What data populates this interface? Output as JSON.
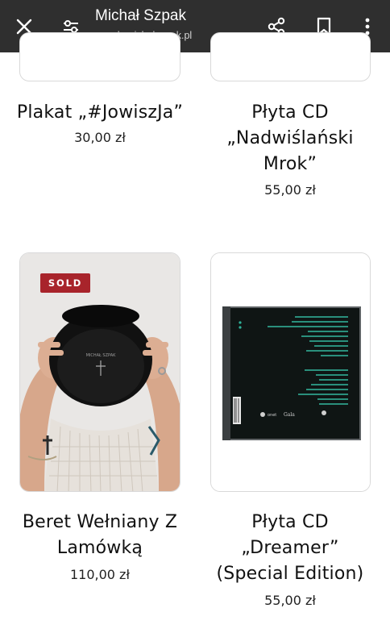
{
  "browser": {
    "title": "Michał Szpak",
    "url": "merch.michalszpak.pl",
    "icons": [
      "close-icon",
      "tune-icon",
      "share-icon",
      "bookmark-icon",
      "more-vert-icon"
    ]
  },
  "products": [
    {
      "title_lines": [
        "Plakat „#JowiszJa”"
      ],
      "price": "30,00 zł",
      "badge": ""
    },
    {
      "title_lines": [
        "Płyta CD",
        "„Nadwiślański",
        "Mrok”"
      ],
      "price": "55,00 zł",
      "badge": ""
    },
    {
      "title_lines": [
        "Beret Wełniany Z",
        "Lamówką"
      ],
      "price": "110,00 zł",
      "badge": "SOLD"
    },
    {
      "title_lines": [
        "Płyta CD",
        "„Dreamer”",
        "(Special Edition)"
      ],
      "price": "55,00 zł",
      "badge": ""
    }
  ],
  "colors": {
    "topbar": "#2f2f2f",
    "sold_badge": "#a8242b"
  }
}
